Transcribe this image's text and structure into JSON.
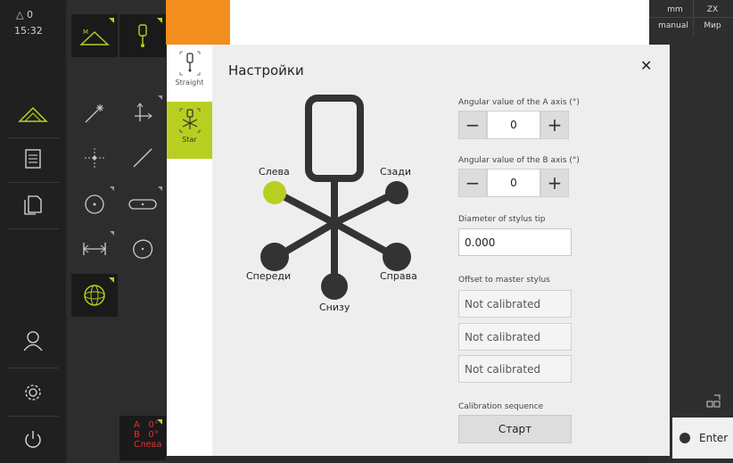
{
  "status_bar": {
    "delta_value": "0",
    "time": "15:32"
  },
  "units": {
    "length": "mm",
    "angle_mode": "manual",
    "plane": "ZX",
    "coord_system": "Мир"
  },
  "left_nav": [
    "measure-icon",
    "document-icon",
    "copy-icon",
    "user-icon",
    "settings-icon",
    "power-icon"
  ],
  "palette": {
    "tools": [
      "auto-measure-icon",
      "probe-icon",
      "sparkle-icon",
      "axis-icon",
      "point-icon",
      "line-icon",
      "circle-icon",
      "slot-icon",
      "distance-icon",
      "blob-icon",
      "sphere-icon"
    ]
  },
  "stylus_status": {
    "a": "A",
    "a_val": "0°",
    "b": "B",
    "b_val": "0°",
    "position": "Слева"
  },
  "dialog": {
    "title": "Настройки",
    "tabs": [
      {
        "label": "Straight"
      },
      {
        "label": "Star"
      }
    ],
    "positions": {
      "left": "Слева",
      "back": "Сзади",
      "front": "Спереди",
      "right": "Справа",
      "bottom": "Снизу"
    },
    "angle_a": {
      "label": "Angular value of the A axis (°)",
      "value": "0"
    },
    "angle_b": {
      "label": "Angular value of the B axis (°)",
      "value": "0"
    },
    "diameter": {
      "label": "Diameter of stylus tip",
      "value": "0.000"
    },
    "offset": {
      "label": "Offset to master stylus",
      "values": [
        "Not calibrated",
        "Not calibrated",
        "Not calibrated"
      ]
    },
    "calibration": {
      "label": "Calibration sequence",
      "button": "Старт"
    }
  },
  "enter_button": "Enter",
  "colors": {
    "accent": "#b8cf22",
    "orange": "#f28e1e",
    "stylus": "#333333"
  }
}
